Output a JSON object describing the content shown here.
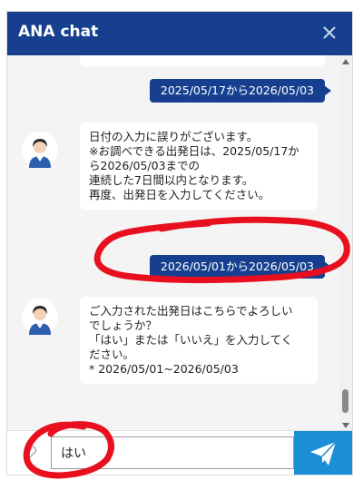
{
  "header": {
    "title": "ANA chat"
  },
  "messages": {
    "user1": "2025/05/17から2026/05/03",
    "bot1": {
      "lines": [
        "日付の入力に誤りがございます。",
        "※お調べできる出発日は、2025/05/17か",
        "ら2026/05/03までの",
        "連続した7日間以内となります。",
        "再度、出発日を入力してください。"
      ]
    },
    "user2": "2026/05/01から2026/05/03",
    "bot2": {
      "lines": [
        "ご入力された出発日はこちらでよろしい",
        "でしょうか？",
        "「はい」または「いいえ」を入力してく",
        "ださい。",
        "* 2026/05/01~2026/05/03"
      ]
    }
  },
  "input": {
    "value": "はい"
  },
  "colors": {
    "header": "#16408f",
    "user_bubble": "#16408f",
    "send_button": "#1a8fd6",
    "annotation": "#e8101e"
  }
}
